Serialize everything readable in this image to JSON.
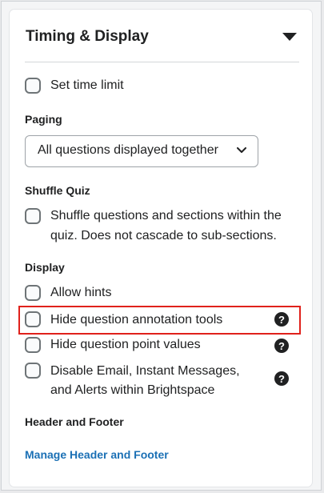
{
  "panel": {
    "title": "Timing & Display",
    "collapse_icon": "caret-down-icon"
  },
  "time_limit": {
    "label": "Set time limit",
    "checked": false
  },
  "paging": {
    "heading": "Paging",
    "selected": "All questions displayed together"
  },
  "shuffle": {
    "heading": "Shuffle Quiz",
    "line1": "Shuffle questions and sections within the",
    "line2": "quiz. Does not cascade to sub-sections.",
    "checked": false
  },
  "display": {
    "heading": "Display",
    "allow_hints": "Allow hints",
    "hide_annotation": "Hide question annotation tools",
    "hide_points": "Hide question point values",
    "disable_line1": "Disable Email, Instant Messages,",
    "disable_line2": "and Alerts within Brightspace"
  },
  "help_glyph": "?",
  "header_footer": {
    "heading": "Header and Footer",
    "link": "Manage Header and Footer"
  },
  "colors": {
    "highlight": "#e0211b",
    "link": "#1b70b5"
  }
}
